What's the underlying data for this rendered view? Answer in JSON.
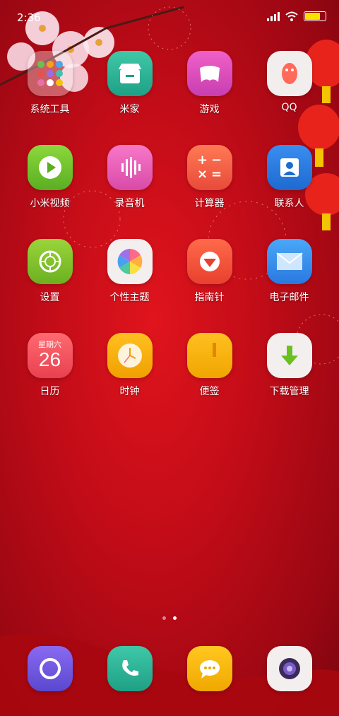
{
  "status": {
    "time": "2:36"
  },
  "colors": {
    "wallpaper": "#c20c18",
    "accent_gold": "#f5c400"
  },
  "apps": [
    {
      "id": "system-tools",
      "label": "系统工具",
      "icon": "folder-icon"
    },
    {
      "id": "mijia",
      "label": "米家",
      "icon": "store-icon"
    },
    {
      "id": "games",
      "label": "游戏",
      "icon": "gamepad-icon"
    },
    {
      "id": "qq",
      "label": "QQ",
      "icon": "penguin-icon"
    },
    {
      "id": "mi-video",
      "label": "小米视频",
      "icon": "play-icon"
    },
    {
      "id": "recorder",
      "label": "录音机",
      "icon": "waveform-icon"
    },
    {
      "id": "calculator",
      "label": "计算器",
      "icon": "calculator-icon"
    },
    {
      "id": "contacts",
      "label": "联系人",
      "icon": "person-icon"
    },
    {
      "id": "settings",
      "label": "设置",
      "icon": "gear-icon"
    },
    {
      "id": "themes",
      "label": "个性主题",
      "icon": "pinwheel-icon"
    },
    {
      "id": "compass",
      "label": "指南针",
      "icon": "compass-icon"
    },
    {
      "id": "email",
      "label": "电子邮件",
      "icon": "envelope-icon"
    },
    {
      "id": "calendar",
      "label": "日历",
      "icon": "calendar-icon"
    },
    {
      "id": "clock",
      "label": "时钟",
      "icon": "clock-icon"
    },
    {
      "id": "notes",
      "label": "便签",
      "icon": "notes-icon"
    },
    {
      "id": "downloads",
      "label": "下载管理",
      "icon": "download-icon"
    }
  ],
  "calendar": {
    "weekday": "星期六",
    "day": "26"
  },
  "calculator_glyphs": [
    "+",
    "−",
    "×",
    "="
  ],
  "page_indicator": {
    "count": 2,
    "active": 1
  },
  "dock": [
    {
      "id": "browser",
      "icon": "ring-icon"
    },
    {
      "id": "phone",
      "icon": "phone-icon"
    },
    {
      "id": "messages",
      "icon": "chat-icon"
    },
    {
      "id": "camera",
      "icon": "camera-icon"
    }
  ]
}
